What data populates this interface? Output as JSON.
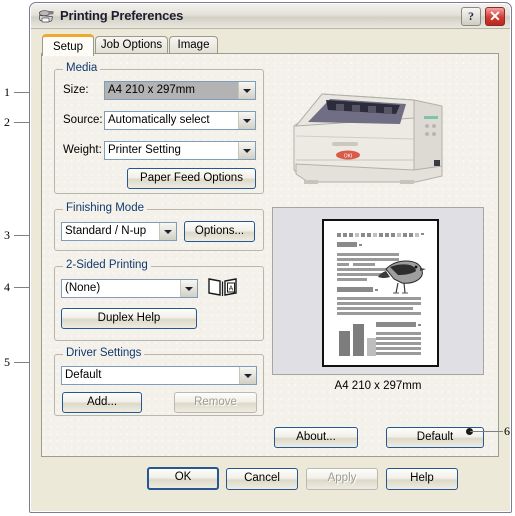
{
  "window": {
    "title": "Printing Preferences",
    "icon": "printer-icon",
    "help_button": "?",
    "close_button": "✕"
  },
  "tabs": [
    {
      "label": "Setup",
      "active": true
    },
    {
      "label": "Job Options",
      "active": false
    },
    {
      "label": "Image",
      "active": false
    }
  ],
  "media": {
    "legend": "Media",
    "size": {
      "label": "Size:",
      "value": "A4 210 x 297mm",
      "state": "selected"
    },
    "source": {
      "label": "Source:",
      "value": "Automatically select"
    },
    "weight": {
      "label": "Weight:",
      "value": "Printer Setting"
    },
    "paper_feed_button": "Paper Feed Options"
  },
  "finishing": {
    "legend": "Finishing Mode",
    "mode_value": "Standard / N-up",
    "options_button": "Options..."
  },
  "two_sided": {
    "legend": "2-Sided Printing",
    "value": "(None)",
    "duplex_help_button": "Duplex Help",
    "book_icon_letter": "A"
  },
  "driver_settings": {
    "legend": "Driver Settings",
    "value": "Default",
    "add_button": "Add...",
    "remove_button": "Remove",
    "remove_disabled": true
  },
  "preview": {
    "caption": "A4 210 x 297mm"
  },
  "panel_buttons": {
    "about": "About...",
    "default": "Default"
  },
  "dialog_buttons": {
    "ok": "OK",
    "cancel": "Cancel",
    "apply": "Apply",
    "apply_disabled": true,
    "help": "Help"
  },
  "callouts": [
    {
      "number": "1",
      "target": "media-size-row"
    },
    {
      "number": "2",
      "target": "media-source-row"
    },
    {
      "number": "3",
      "target": "finishing-mode-combo"
    },
    {
      "number": "4",
      "target": "two-sided-combo"
    },
    {
      "number": "5",
      "target": "driver-settings-combo"
    },
    {
      "number": "6",
      "target": "default-button"
    }
  ],
  "colors": {
    "accent_tab": "#f0a830",
    "dialog_face": "#ece9d8",
    "panel_face": "#f3f1ea",
    "group_label": "#123a6e",
    "button_border": "#26578f",
    "close_button": "#cf3b32"
  }
}
